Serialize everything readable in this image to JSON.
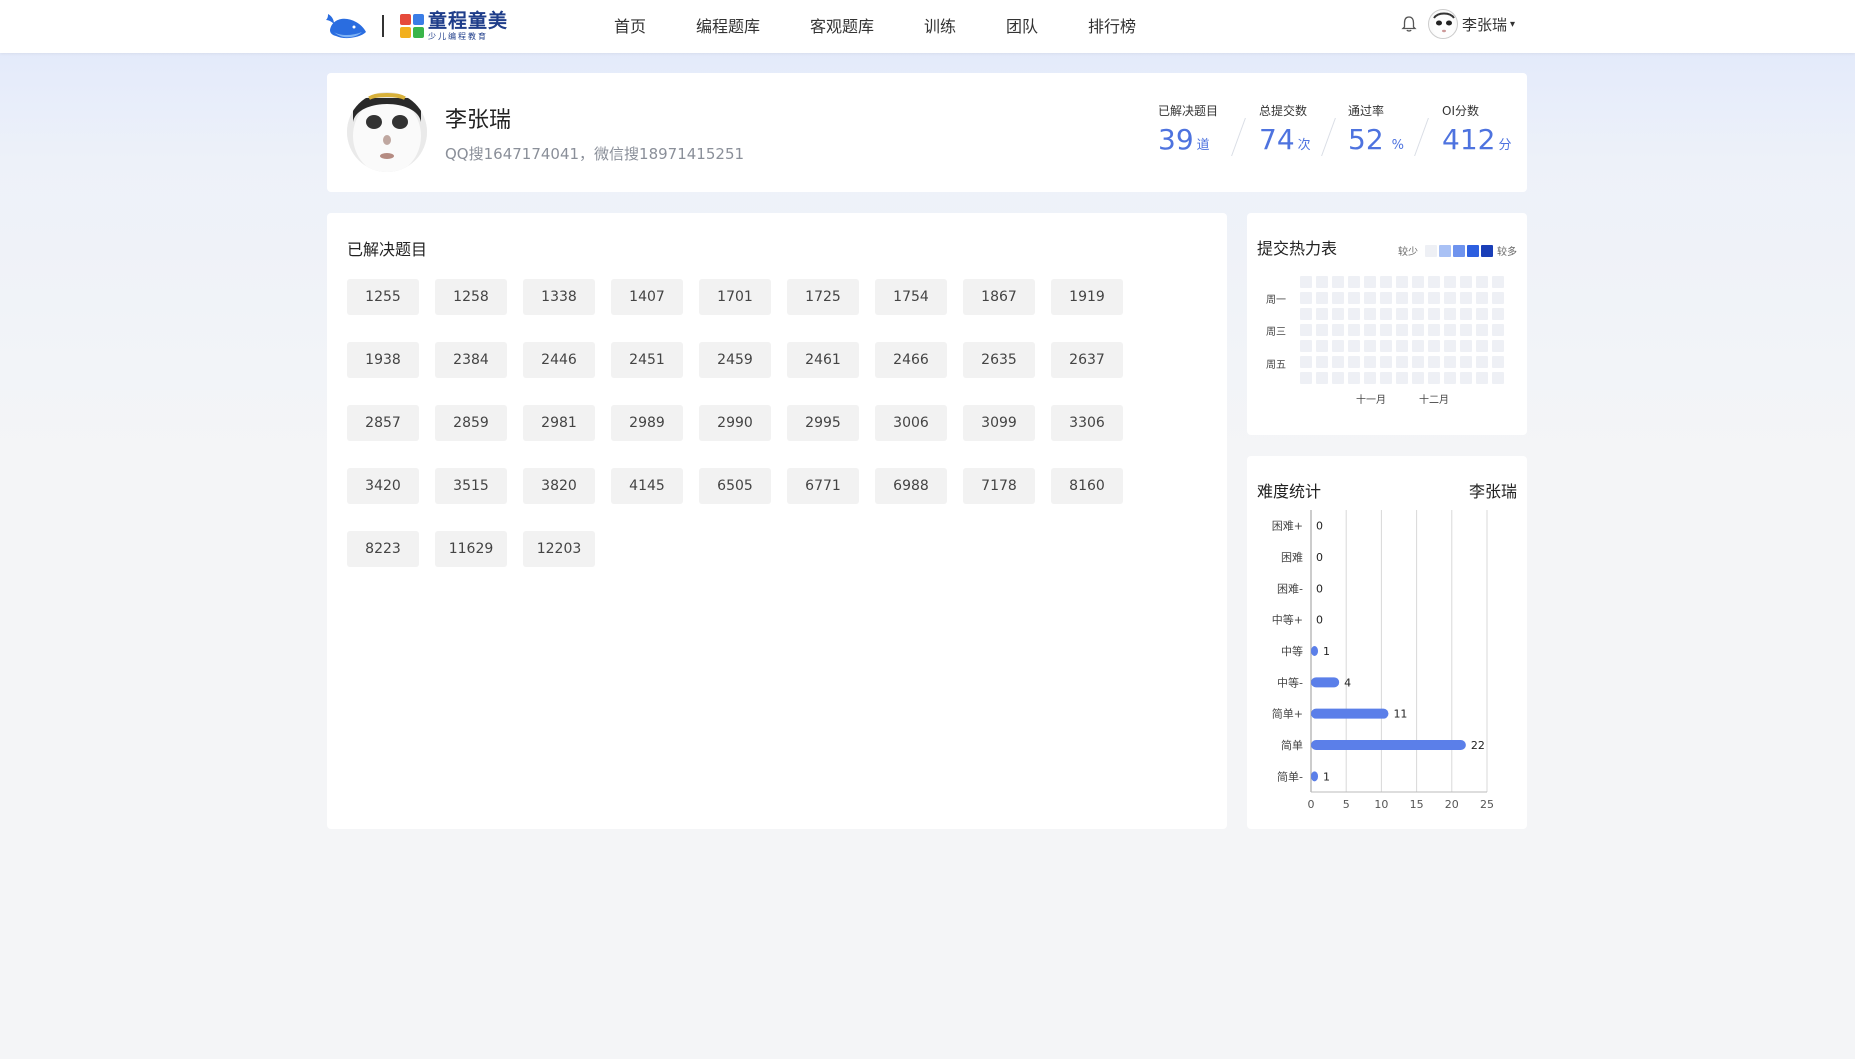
{
  "header": {
    "brand": {
      "main": "童程童美",
      "sub": "少儿编程教育"
    },
    "nav": [
      {
        "label": "首页"
      },
      {
        "label": "编程题库"
      },
      {
        "label": "客观题库"
      },
      {
        "label": "训练"
      },
      {
        "label": "团队"
      },
      {
        "label": "排行榜"
      }
    ],
    "user_name": "李张瑞",
    "caret": "▾"
  },
  "profile": {
    "name": "李张瑞",
    "contact": "QQ搜1647174041，微信搜18971415251",
    "stats": [
      {
        "label": "已解决题目",
        "value": "39",
        "unit": "道"
      },
      {
        "label": "总提交数",
        "value": "74",
        "unit": "次"
      },
      {
        "label": "通过率",
        "value": "52",
        "unit": "%"
      },
      {
        "label": "OI分数",
        "value": "412",
        "unit": "分"
      }
    ]
  },
  "solved": {
    "title": "已解决题目",
    "problems": [
      "1255",
      "1258",
      "1338",
      "1407",
      "1701",
      "1725",
      "1754",
      "1867",
      "1919",
      "1938",
      "2384",
      "2446",
      "2451",
      "2459",
      "2461",
      "2466",
      "2635",
      "2637",
      "2857",
      "2859",
      "2981",
      "2989",
      "2990",
      "2995",
      "3006",
      "3099",
      "3306",
      "3420",
      "3515",
      "3820",
      "4145",
      "6505",
      "6771",
      "6988",
      "7178",
      "8160",
      "8223",
      "11629",
      "12203"
    ]
  },
  "heatmap": {
    "title": "提交热力表",
    "legend_less": "较少",
    "legend_more": "较多",
    "legend_colors": [
      "#eef0f5",
      "#a9c1f5",
      "#6e93ee",
      "#2d5fe0",
      "#1a3fb8"
    ],
    "days": [
      "周一",
      "周三",
      "周五"
    ],
    "months": [
      "十一月",
      "十二月"
    ]
  },
  "difficulty": {
    "title": "难度统计",
    "user": "李张瑞",
    "bar_color": "#5b7fe9"
  },
  "chart_data": {
    "type": "bar",
    "orientation": "horizontal",
    "categories": [
      "困难+",
      "困难",
      "困难-",
      "中等+",
      "中等",
      "中等-",
      "简单+",
      "简单",
      "简单-"
    ],
    "values": [
      0,
      0,
      0,
      0,
      1,
      4,
      11,
      22,
      1
    ],
    "xlim": [
      0,
      25
    ],
    "xticks": [
      0,
      5,
      10,
      15,
      20,
      25
    ],
    "grid": true,
    "xlabel": "",
    "ylabel": ""
  }
}
